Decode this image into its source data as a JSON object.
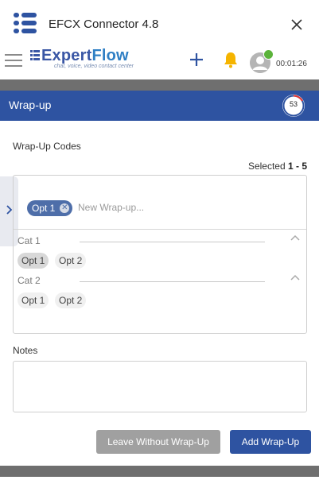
{
  "titlebar": {
    "app_title": "EFCX Connector 4.8",
    "close_icon": "close-icon"
  },
  "header": {
    "brand_part1": "Expert",
    "brand_part2": "Flow",
    "brand_tagline": "chat, voice, video contact center",
    "timer": "00:01:26",
    "agent_status_color": "#5bb33a"
  },
  "wrapup": {
    "title": "Wrap-up",
    "countdown": "53",
    "codes_label": "Wrap-Up Codes",
    "selected_prefix": "Selected ",
    "selected_value": "1 - 5",
    "selected_chip": "Opt 1",
    "input_placeholder": "New Wrap-up...",
    "categories": [
      {
        "name": "Cat 1",
        "options": [
          "Opt 1",
          "Opt 2"
        ],
        "selected": "Opt 1"
      },
      {
        "name": "Cat 2",
        "options": [
          "Opt 1",
          "Opt 2"
        ],
        "selected": ""
      }
    ],
    "notes_label": "Notes",
    "notes_value": "",
    "leave_button": "Leave Without Wrap-Up",
    "add_button": "Add Wrap-Up"
  },
  "colors": {
    "accent": "#2e53a1",
    "chip": "#4e6ea9",
    "muted_button": "#a0a0a0",
    "bell": "#f5b400"
  }
}
